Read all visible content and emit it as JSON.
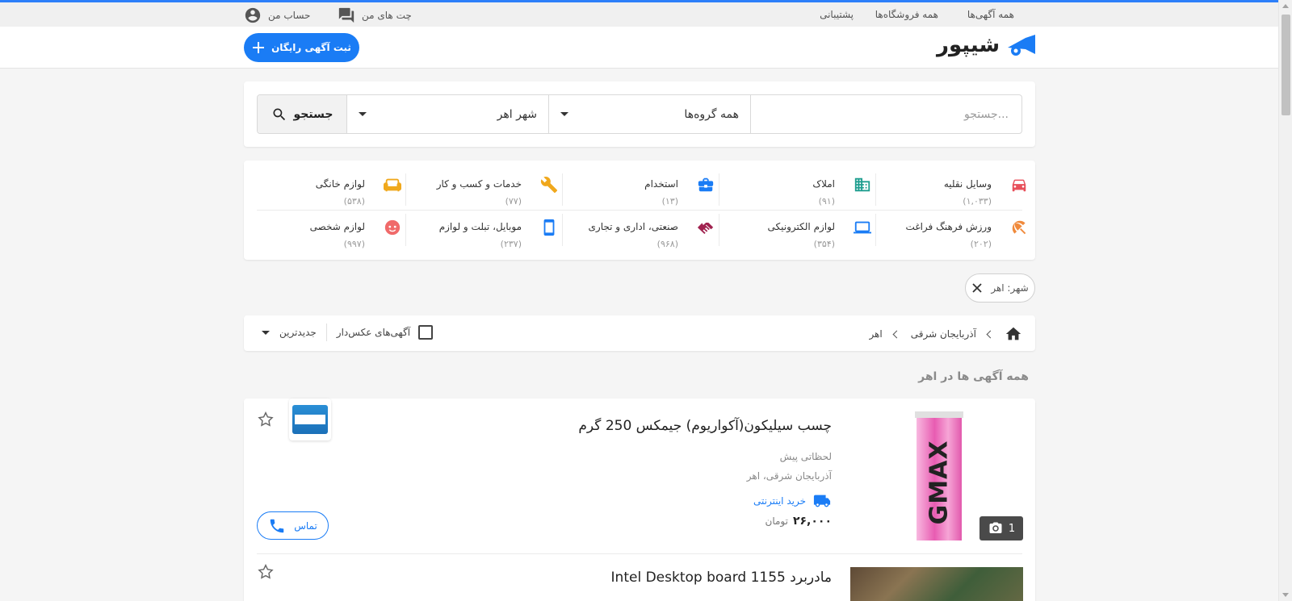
{
  "colors": {
    "accent": "#1a7cf5",
    "top_line": "#2d7ff9"
  },
  "topbar": {
    "all_ads": "همه آگهی‌ها",
    "all_shops": "همه فروشگاه‌ها",
    "support": "پشتیبانی",
    "chats": "چت های من",
    "account": "حساب من"
  },
  "header": {
    "logo_text": "شیپور",
    "post_ad_label": "ثبت آگهی رایگان"
  },
  "search": {
    "placeholder": "جستجو...",
    "group_selected": "همه گروه‌ها",
    "city_selected": "شهر اهر",
    "button_label": "جستجو"
  },
  "categories": [
    {
      "name": "وسایل نقلیه",
      "count": "(۱,۰۳۳)",
      "icon": "car-icon",
      "color": "#e8505b"
    },
    {
      "name": "املاک",
      "count": "(۹۱)",
      "icon": "building-icon",
      "color": "#1e9e8f"
    },
    {
      "name": "استخدام",
      "count": "(۱۳)",
      "icon": "briefcase-icon",
      "color": "#1a7cf5"
    },
    {
      "name": "خدمات و کسب و کار",
      "count": "(۷۷)",
      "icon": "wrench-icon",
      "color": "#f0a81c"
    },
    {
      "name": "لوازم خانگی",
      "count": "(۵۳۸)",
      "icon": "sofa-icon",
      "color": "#f0a81c"
    },
    {
      "name": "ورزش فرهنگ فراغت",
      "count": "(۲۰۲)",
      "icon": "umbrella-icon",
      "color": "#f08a3c"
    },
    {
      "name": "لوازم الکترونیکی",
      "count": "(۳۵۴)",
      "icon": "laptop-icon",
      "color": "#1a7cf5"
    },
    {
      "name": "صنعتی، اداری و تجاری",
      "count": "(۹۶۸)",
      "icon": "handshake-icon",
      "color": "#a0224f"
    },
    {
      "name": "موبایل، تبلت و لوازم",
      "count": "(۲۳۷)",
      "icon": "mobile-icon",
      "color": "#1a7cf5"
    },
    {
      "name": "لوازم شخصی",
      "count": "(۹۹۷)",
      "icon": "face-icon",
      "color": "#f06a6a"
    }
  ],
  "filter_chip": {
    "label": "شهر: اهر"
  },
  "breadcrumb": {
    "province": "آذربایجان شرقی",
    "city": "اهر"
  },
  "sort": {
    "photo_only_label": "آگهی‌های عکس‌دار",
    "selected": "جدیدترین"
  },
  "section_title": "همه آگهی ها در اهر",
  "listings": [
    {
      "title": "چسب سیلیکون(آکواریوم) جیمکس 250 گرم",
      "time": "لحظاتی پیش",
      "location": "آذربایجان شرقی، اهر",
      "shop_label": "خرید اینترنتی",
      "price": "۲۶,۰۰۰",
      "currency": "تومان",
      "photo_count": "1",
      "call_label": "تماس",
      "product_mark": "GMAX"
    },
    {
      "title": "مادربرد Intel Desktop board 1155"
    }
  ]
}
